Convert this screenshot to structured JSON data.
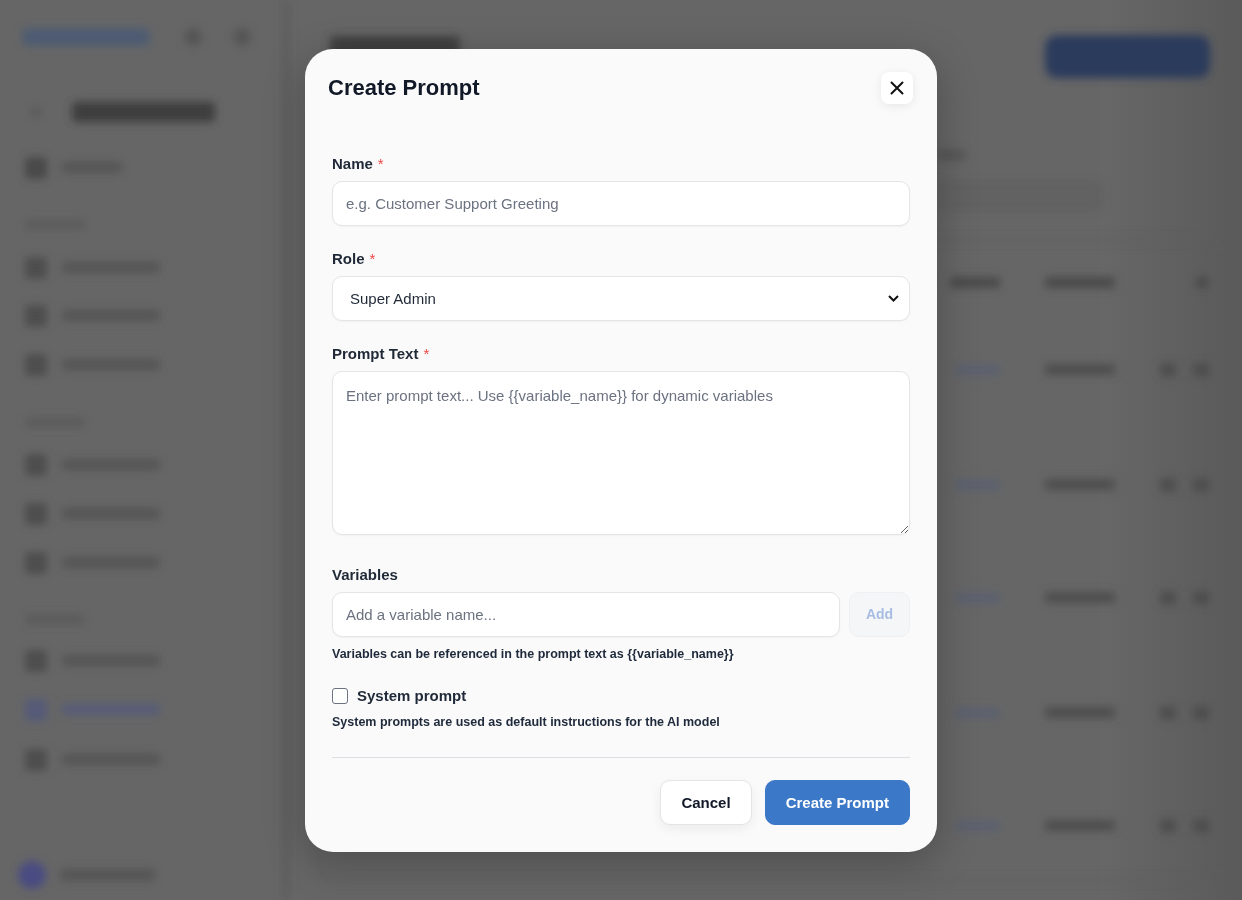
{
  "dialog": {
    "title": "Create Prompt"
  },
  "fields": [
    {
      "kind": "text",
      "label": "Name",
      "required_mark": "*",
      "placeholder": "e.g. Customer Support Greeting"
    },
    {
      "kind": "select",
      "label": "Role",
      "required_mark": "*",
      "value": "Super Admin"
    },
    {
      "kind": "textarea",
      "label": "Prompt Text",
      "required_mark": "*",
      "placeholder": "Enter prompt text... Use {{variable_name}} for dynamic variables"
    },
    {
      "kind": "variables",
      "label": "Variables",
      "placeholder": "Add a variable name...",
      "button": {
        "label": "Add",
        "disabled": true
      },
      "help": "Variables can be referenced in the prompt text as {{variable_name}}"
    },
    {
      "kind": "checkbox",
      "label": "System prompt",
      "checked": false,
      "help": "System prompts are used as default instructions for the AI model"
    }
  ],
  "actions": [
    {
      "kind": "secondary",
      "label": "Cancel"
    },
    {
      "kind": "primary",
      "label": "Create Prompt"
    }
  ]
}
